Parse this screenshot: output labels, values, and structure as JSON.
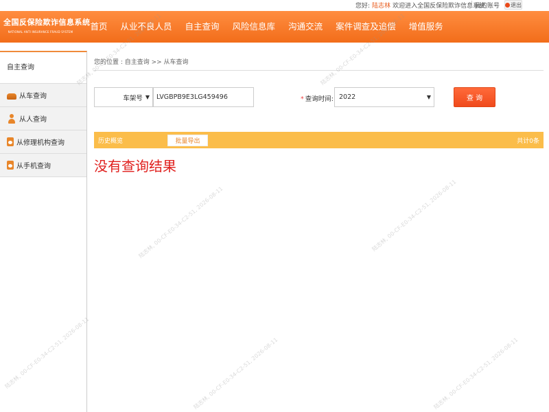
{
  "topbar": {
    "greeting_prefix": "您好:",
    "username": "陆志林",
    "welcome": "欢迎进入全国反保险欺诈信息系统",
    "separator": "|",
    "account": "我的账号",
    "logout": "退出"
  },
  "brand": {
    "title_cn": "全国反保险欺诈信息系统",
    "title_en": "NATIONAL ANTI INSURANCE FRAUD SYSTEM",
    "brand_color": "#f26d1a"
  },
  "nav": {
    "items": [
      "首页",
      "从业不良人员",
      "自主查询",
      "风险信息库",
      "沟通交流",
      "案件调查及追偿",
      "增值服务"
    ]
  },
  "sidebar": {
    "title": "自主查询",
    "items": [
      {
        "label": "从车查询",
        "icon": "car-icon"
      },
      {
        "label": "从人查询",
        "icon": "person-icon"
      },
      {
        "label": "从修理机构查询",
        "icon": "repair-shop-icon"
      },
      {
        "label": "从手机查询",
        "icon": "phone-icon"
      }
    ]
  },
  "breadcrumb": "您的位置 : 自主查询 >> 从车查询",
  "form": {
    "type_select": "车架号",
    "vin_value": "LVGBPB9E3LG459496",
    "time_required_mark": "*",
    "time_label": "查询时间:",
    "year_select": "2022",
    "query_button": "查 询"
  },
  "results": {
    "title": "历史概览",
    "export_button": "批量导出",
    "total": "共计0条",
    "empty_message": "没有查询结果",
    "bar_color": "#fbbd4a"
  },
  "watermark": "陆志林, 00-CF-E0-34-C2-51, 2026-08-11"
}
